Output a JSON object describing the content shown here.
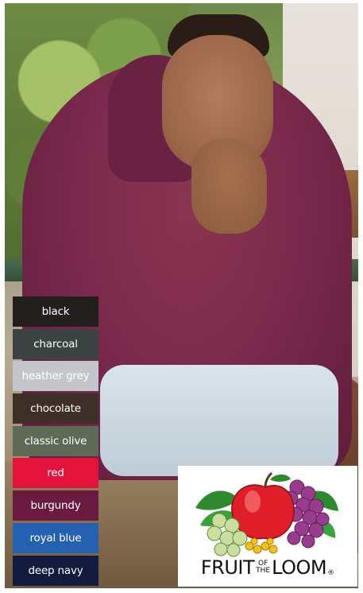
{
  "swatches": [
    {
      "label": "black",
      "color": "#231f1e",
      "text_color": "#ffffff"
    },
    {
      "label": "charcoal",
      "color": "#3b4443",
      "text_color": "#ffffff"
    },
    {
      "label": "heather grey",
      "color": "#c3c7cb",
      "text_color": "#ffffff"
    },
    {
      "label": "chocolate",
      "color": "#3f3027",
      "text_color": "#ffffff"
    },
    {
      "label": "classic olive",
      "color": "#5e6a56",
      "text_color": "#ffffff"
    },
    {
      "label": "red",
      "color": "#e4133b",
      "text_color": "#ffffff"
    },
    {
      "label": "burgundy",
      "color": "#691a3e",
      "text_color": "#ffffff"
    },
    {
      "label": "royal blue",
      "color": "#2461b1",
      "text_color": "#ffffff"
    },
    {
      "label": "deep navy",
      "color": "#121b3e",
      "text_color": "#ffffff"
    }
  ],
  "logo": {
    "word_fruit": "FRUIT",
    "word_of": "OF",
    "word_the": "THE",
    "word_loom": "LOOM",
    "registered": "®"
  }
}
